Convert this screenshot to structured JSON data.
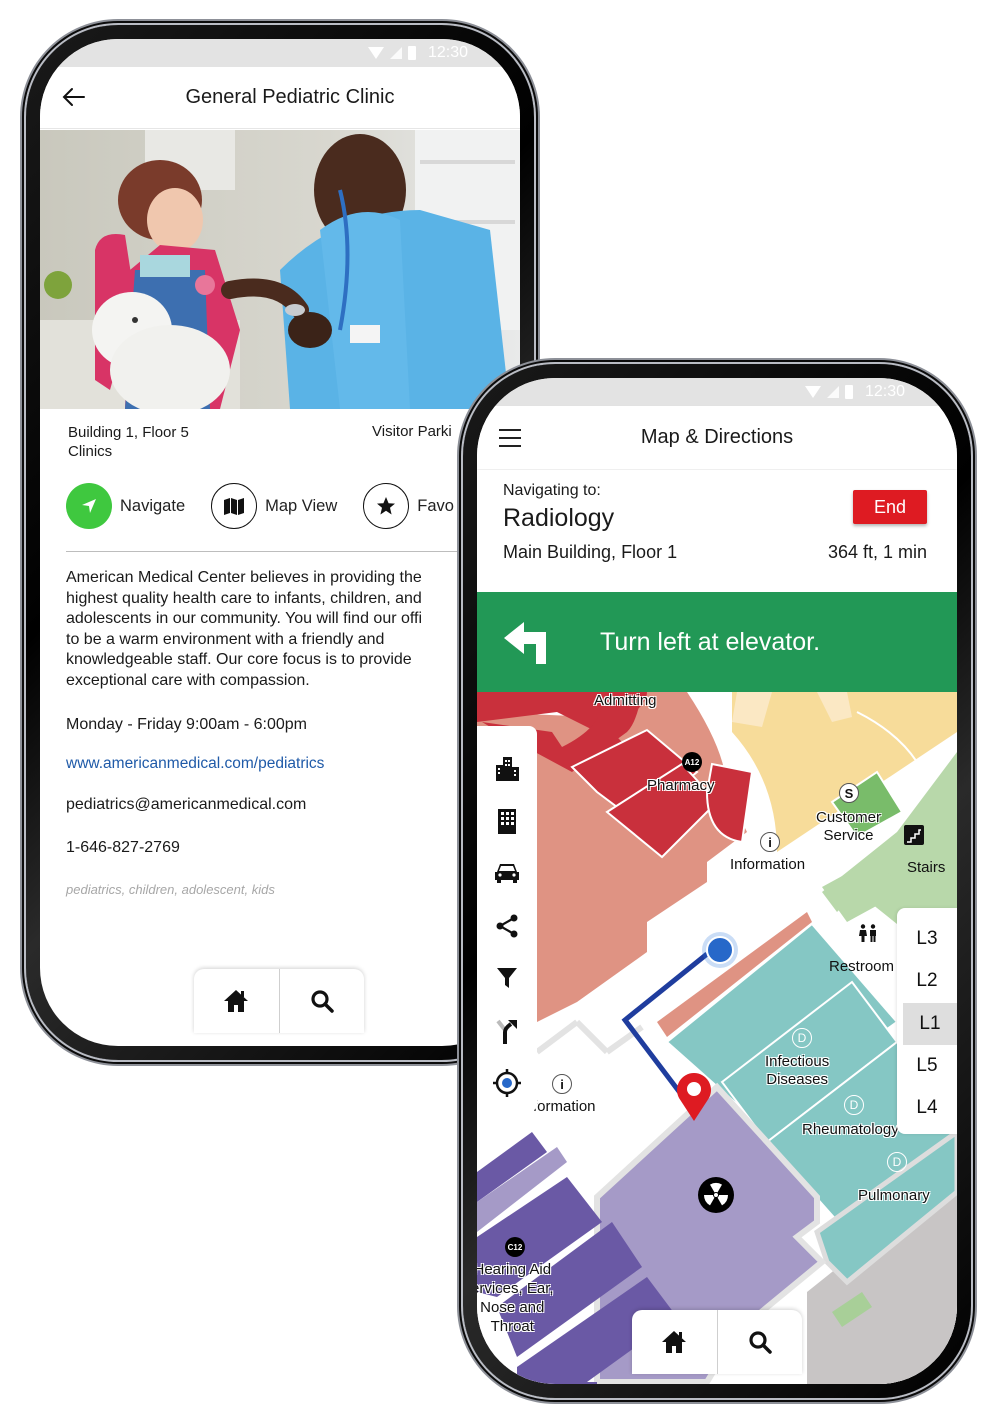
{
  "phone1": {
    "status_bar": {
      "time": "12:30"
    },
    "header": {
      "title": "General Pediatric Clinic",
      "back_icon": "arrow-left-icon"
    },
    "photo": {
      "alt": "Doctor examining child with stethoscope"
    },
    "location": {
      "line1": "Building 1, Floor 5",
      "line2": "Clinics"
    },
    "parking": "Visitor Parki",
    "actions": [
      {
        "label": "Navigate",
        "icon": "navigate-arrow-icon",
        "color": "#3fc83f"
      },
      {
        "label": "Map View",
        "icon": "map-icon"
      },
      {
        "label": "Favo",
        "icon": "star-icon"
      }
    ],
    "description": "American Medical Center believes in providing the\nhighest quality health care to infants, children, and\nadolescents in our community. You will find our offi\nto be a warm environment with a friendly and\nknowledgeable staff.  Our core focus is to provide\nexceptional care with compassion.",
    "hours": "Monday - Friday 9:00am - 6:00pm",
    "website": "www.americanmedical.com/pediatrics",
    "email": "pediatrics@americanmedical.com",
    "phone": "1-646-827-2769",
    "tags": "pediatrics, children, adolescent, kids",
    "bottom_bar": {
      "home_icon": "home-icon",
      "search_icon": "search-icon"
    }
  },
  "phone2": {
    "status_bar": {
      "time": "12:30"
    },
    "header": {
      "title": "Map & Directions",
      "menu_icon": "hamburger-menu-icon"
    },
    "navigation": {
      "label": "Navigating to:",
      "destination": "Radiology",
      "destination_location": "Main Building, Floor 1",
      "end_label": "End",
      "eta": "364 ft, 1 min",
      "end_color": "#de1b22"
    },
    "instruction": {
      "text": "Turn left at elevator.",
      "icon": "turn-left-icon",
      "color": "#229856"
    },
    "map": {
      "labels": {
        "admitting": "Admitting",
        "pharmacy": "Pharmacy",
        "pharmacy_badge": "A12",
        "customer_service_1": "Customer",
        "customer_service_2": "Service",
        "customer_service_badge": "S",
        "information": "Information",
        "information_icon": "i",
        "information2": "formation",
        "stairs": "Stairs",
        "restroom": "Restroom",
        "infectious_1": "Infectious",
        "infectious_2": "Diseases",
        "rheumatology": "Rheumatology",
        "pulmonary": "Pulmonary",
        "dept_badge": "D",
        "hearing_badge": "C12",
        "hearing_1": "Hearing Aid",
        "hearing_2": "ervices, Ear,",
        "hearing_3": "Nose and",
        "hearing_4": "Throat"
      },
      "toolbar": [
        {
          "name": "buildings",
          "icon": "buildings-icon"
        },
        {
          "name": "building",
          "icon": "building-icon"
        },
        {
          "name": "parking",
          "icon": "car-icon"
        },
        {
          "name": "share",
          "icon": "share-icon"
        },
        {
          "name": "filter",
          "icon": "filter-icon"
        },
        {
          "name": "directions",
          "icon": "route-fork-icon"
        },
        {
          "name": "my-location",
          "icon": "locate-icon"
        }
      ],
      "levels": [
        "L3",
        "L2",
        "L1",
        "L5",
        "L4"
      ],
      "active_level": "L1"
    },
    "bottom_bar": {
      "home_icon": "home-icon",
      "search_icon": "search-icon"
    }
  }
}
